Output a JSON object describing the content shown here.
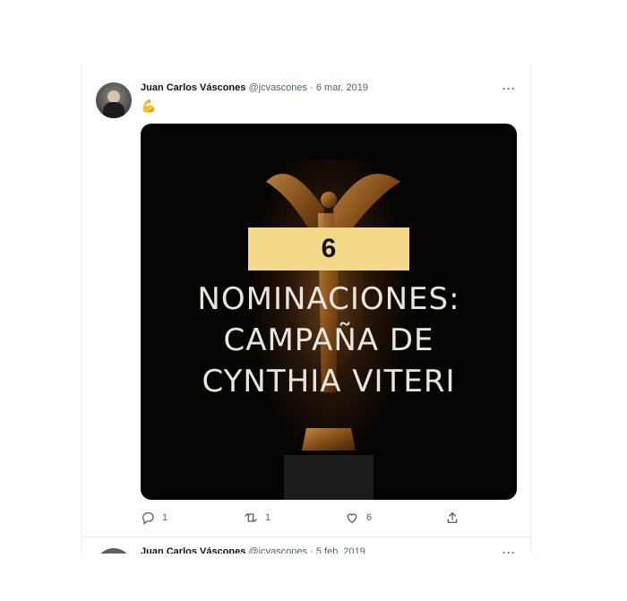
{
  "tweets": [
    {
      "display_name": "Juan Carlos Váscones",
      "handle": "@jcvascones",
      "separator": "·",
      "date": "6 mar. 2019",
      "more_label": "···",
      "body_emoji": "💪",
      "media": {
        "number": "6",
        "lines": [
          "NOMINACIONES:",
          "CAMPAÑA DE",
          "CYNTHIA VITERI"
        ]
      },
      "actions": {
        "reply_count": "1",
        "retweet_count": "1",
        "like_count": "6"
      }
    },
    {
      "display_name": "Juan Carlos Váscones",
      "handle": "@jcvascones",
      "separator": "·",
      "date": "5 feb. 2019",
      "more_label": "···"
    }
  ],
  "icons": {
    "reply": "reply-icon",
    "retweet": "retweet-icon",
    "like": "heart-icon",
    "share": "share-icon",
    "more": "more-icon"
  },
  "colors": {
    "name": "#0f1419",
    "secondary": "#536471",
    "media_bg": "#050403",
    "number_box": "#f5d98a",
    "headline": "#e9e6e0"
  }
}
